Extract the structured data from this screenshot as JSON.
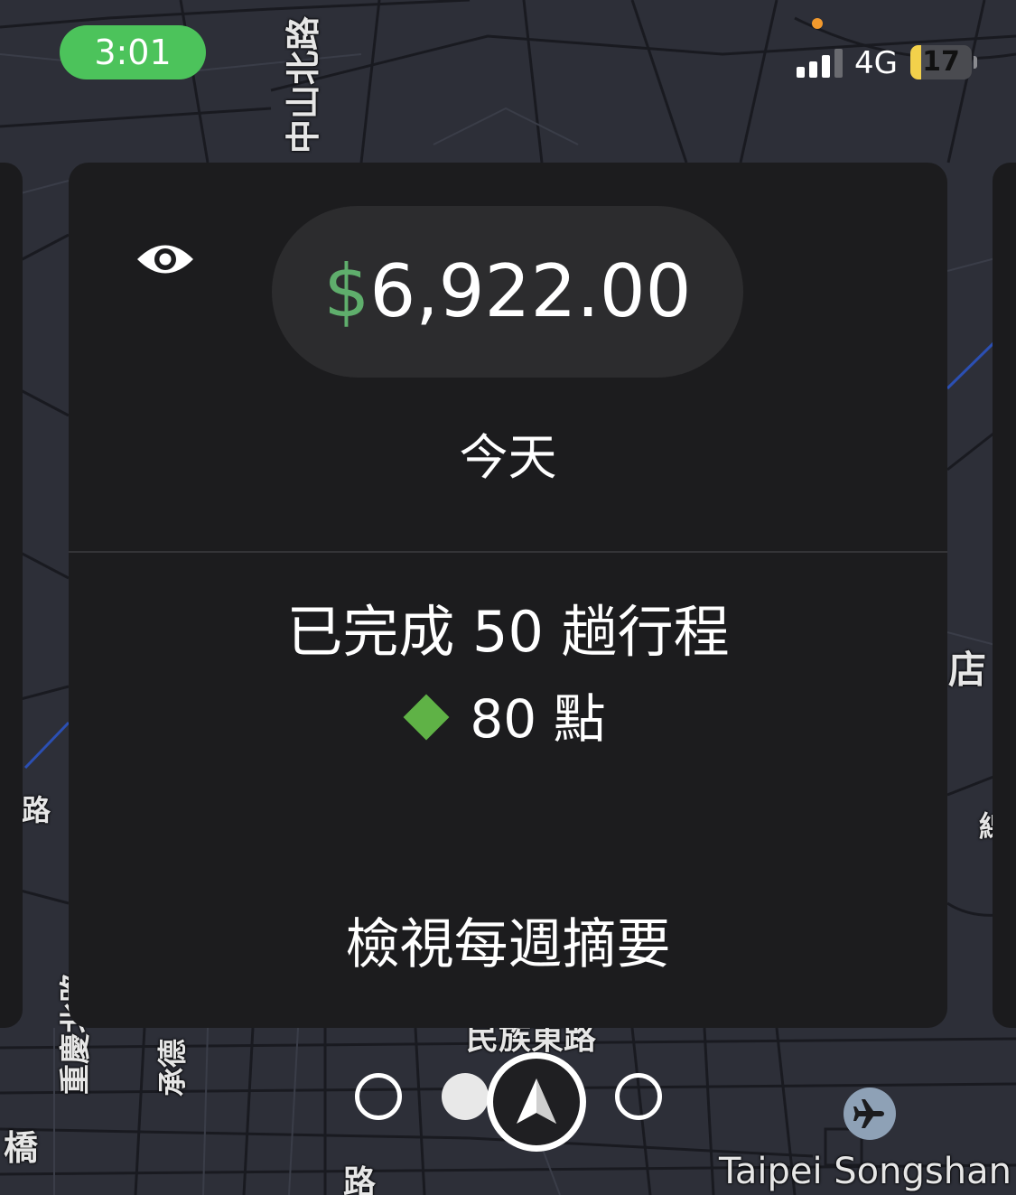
{
  "status_bar": {
    "time": "3:01",
    "network": "4G",
    "battery": "17",
    "battery_level": 0.17
  },
  "map": {
    "labels": {
      "zhongshan_north": "中山北路",
      "shop": "店",
      "left_fragment": "路",
      "chongqing_north": "重慶北路一",
      "chengde": "承德",
      "bridge": "橋",
      "minzu_east": "民族東路",
      "road": "路",
      "right_fragment": "線",
      "airport": "Taipei Songshan"
    }
  },
  "earnings_card": {
    "currency_symbol": "$",
    "amount": "6,922.00",
    "period": "今天",
    "trips_text": "已完成 50 趟行程",
    "points_text": "80 點",
    "weekly_link": "檢視每週摘要"
  },
  "pager": {
    "total": 4,
    "active_index": 1
  },
  "colors": {
    "accent_green": "#5fae6c",
    "diamond_green": "#5fb246",
    "time_pill": "#4cc35b",
    "battery_fill": "#f3d14b",
    "card_bg": "#1c1c1e"
  }
}
